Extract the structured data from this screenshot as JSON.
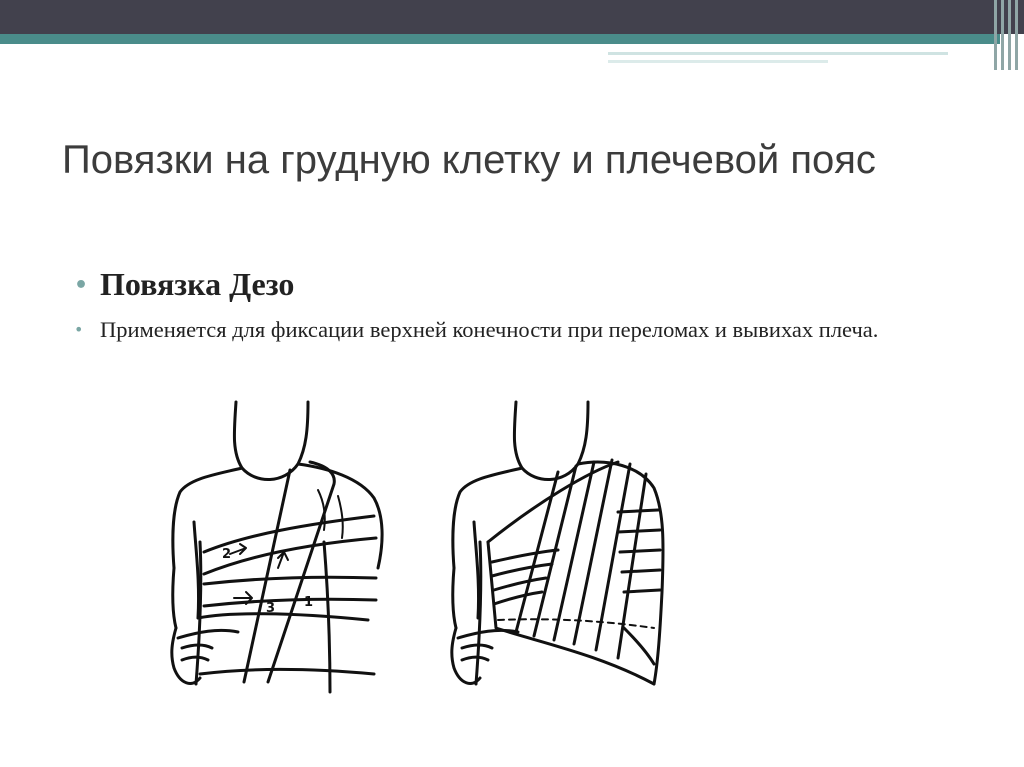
{
  "slide": {
    "title": "Повязки на грудную клетку и плечевой пояс",
    "bullets": [
      "Повязка Дезо",
      "Применяется для фиксации верхней конечности при переломах и вывихах плеча."
    ]
  },
  "illustration": {
    "step_labels": [
      "2",
      "3",
      "1"
    ],
    "figures": [
      "figure-desault-steps",
      "figure-desault-finished"
    ]
  },
  "colors": {
    "top_band": "#42414d",
    "accent_teal": "#4a8c8a",
    "bullet_dot": "#7aa6a4",
    "title_text": "#3c3c3c",
    "body_text": "#222222"
  }
}
